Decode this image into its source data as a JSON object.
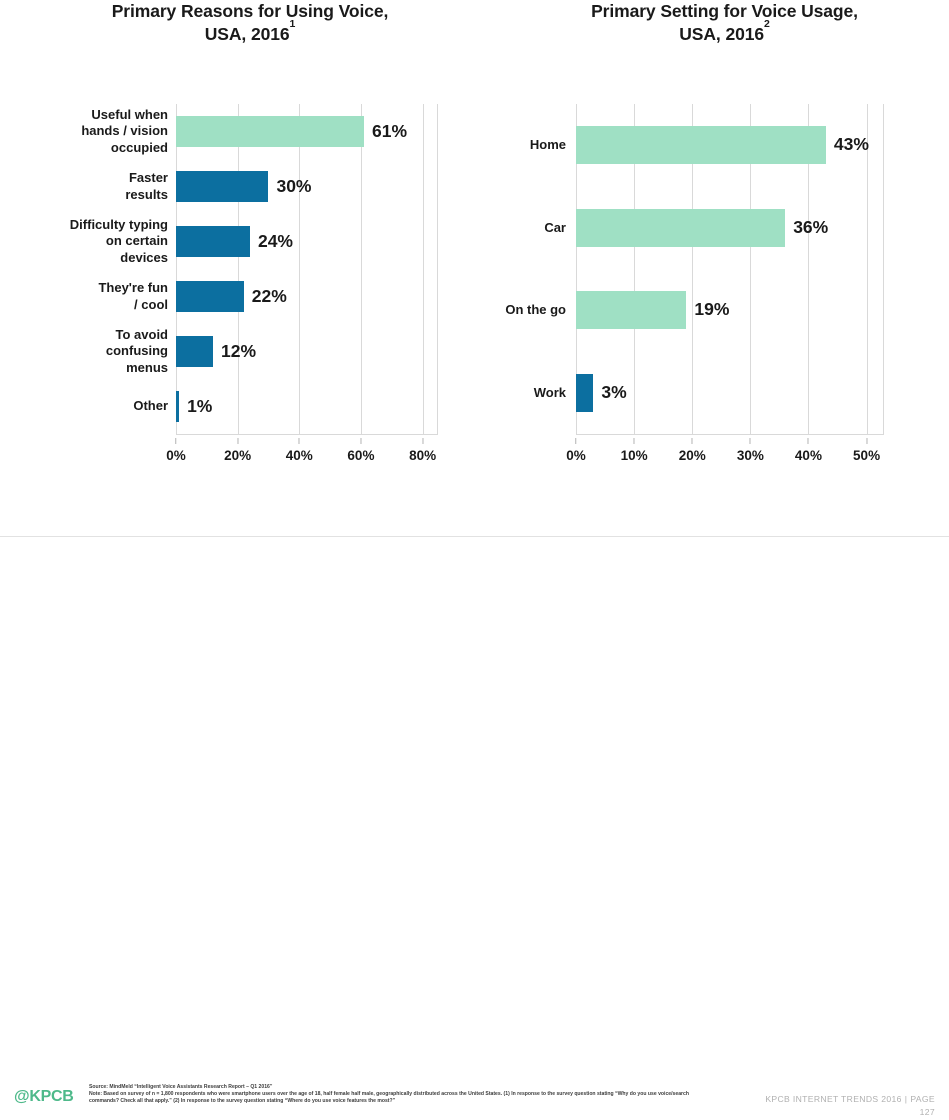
{
  "slide": {
    "footer": {
      "logo_at": "@",
      "logo_text": "KPCB",
      "source": "Source: MindMeld “Intelligent Voice Assistants Research Report – Q1 2016”",
      "note": "Note: Based on survey of n = 1,800 respondents who were smartphone users over the age of 18, half female half male, geographically distributed across the United States. (1) In response to the survey question stating “Why do you use voice/search commands? Check all that apply.” (2) In response to the survey question stating “Where do you use voice features the most?”",
      "deck_label": "KPCB INTERNET TRENDS 2016",
      "separator": "|",
      "page_label": "PAGE",
      "page_number": "127"
    },
    "colors": {
      "mint": "#9fe0c4",
      "blue": "#0c6fa0",
      "gridline": "#d9d9d9",
      "text": "#1a1a1a",
      "logo_green": "#4eb98a",
      "footer_gray": "#b0b0b0"
    }
  },
  "chart_data": [
    {
      "type": "bar",
      "orientation": "horizontal",
      "title": "Primary Reasons for Using Voice, USA, 2016",
      "title_line1": "Primary Reasons for Using Voice,",
      "title_line2": "USA, 2016",
      "title_footnote": "1",
      "xlabel": "",
      "ylabel": "",
      "xlim": [
        0,
        85
      ],
      "xticks": [
        0,
        20,
        40,
        60,
        80
      ],
      "xtick_labels": [
        "0%",
        "20%",
        "40%",
        "60%",
        "80%"
      ],
      "grid": true,
      "legend": "none",
      "categories": [
        "Useful when\nhands / vision\noccupied",
        "Faster\nresults",
        "Difficulty typing\non certain\ndevices",
        "They're fun\n/ cool",
        "To avoid\nconfusing\nmenus",
        "Other"
      ],
      "values": [
        61,
        30,
        24,
        22,
        12,
        1
      ],
      "value_labels": [
        "61%",
        "30%",
        "24%",
        "22%",
        "12%",
        "1%"
      ],
      "bar_colors": [
        "mint",
        "blue",
        "blue",
        "blue",
        "blue",
        "blue"
      ]
    },
    {
      "type": "bar",
      "orientation": "horizontal",
      "title": "Primary Setting for Voice Usage, USA, 2016",
      "title_line1": "Primary Setting for Voice Usage,",
      "title_line2": "USA, 2016",
      "title_footnote": "2",
      "xlabel": "",
      "ylabel": "",
      "xlim": [
        0,
        53
      ],
      "xticks": [
        0,
        10,
        20,
        30,
        40,
        50
      ],
      "xtick_labels": [
        "0%",
        "10%",
        "20%",
        "30%",
        "40%",
        "50%"
      ],
      "grid": true,
      "legend": "none",
      "categories": [
        "Home",
        "Car",
        "On the go",
        "Work"
      ],
      "values": [
        43,
        36,
        19,
        3
      ],
      "value_labels": [
        "43%",
        "36%",
        "19%",
        "3%"
      ],
      "bar_colors": [
        "mint",
        "mint",
        "mint",
        "blue"
      ]
    }
  ]
}
